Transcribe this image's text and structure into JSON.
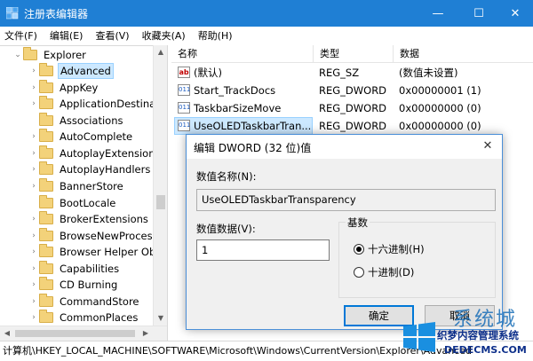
{
  "window": {
    "title": "注册表编辑器",
    "controls": {
      "minimize": "—",
      "maximize": "☐",
      "close": "✕"
    },
    "accent_color": "#1f7fd4"
  },
  "menu": [
    "文件(F)",
    "编辑(E)",
    "查看(V)",
    "收藏夹(A)",
    "帮助(H)"
  ],
  "tree": {
    "parent": "Explorer",
    "items": [
      "Advanced",
      "AppKey",
      "ApplicationDestinat",
      "Associations",
      "AutoComplete",
      "AutoplayExtensions",
      "AutoplayHandlers",
      "BannerStore",
      "BootLocale",
      "BrokerExtensions",
      "BrowseNewProcess",
      "Browser Helper Ob",
      "Capabilities",
      "CD Burning",
      "CommandStore",
      "CommonPlaces"
    ],
    "selected": "Advanced"
  },
  "list": {
    "columns": [
      "名称",
      "类型",
      "数据"
    ],
    "rows": [
      {
        "icon": "string-value-icon",
        "name": "(默认)",
        "type": "REG_SZ",
        "data": "(数值未设置)"
      },
      {
        "icon": "dword-value-icon",
        "name": "Start_TrackDocs",
        "type": "REG_DWORD",
        "data": "0x00000001 (1)"
      },
      {
        "icon": "dword-value-icon",
        "name": "TaskbarSizeMove",
        "type": "REG_DWORD",
        "data": "0x00000000 (0)"
      },
      {
        "icon": "dword-value-icon",
        "name": "UseOLEDTaskbarTran...",
        "type": "REG_DWORD",
        "data": "0x00000000 (0)"
      }
    ],
    "selected_index": 3
  },
  "statusbar": {
    "path": "计算机\\HKEY_LOCAL_MACHINE\\SOFTWARE\\Microsoft\\Windows\\CurrentVersion\\Explorer\\Advanced"
  },
  "dialog": {
    "title": "编辑 DWORD (32 位)值",
    "name_label": "数值名称(N):",
    "name_value": "UseOLEDTaskbarTransparency",
    "data_label": "数值数据(V):",
    "data_value": "1",
    "radix_label": "基数",
    "radix_options": [
      "十六进制(H)",
      "十进制(D)"
    ],
    "radix_selected": 0,
    "ok_label": "确定",
    "cancel_label": "取消"
  },
  "watermark": {
    "big": "系统城",
    "small": "织梦内容管理系统",
    "url": "DEDECMS.COM"
  }
}
